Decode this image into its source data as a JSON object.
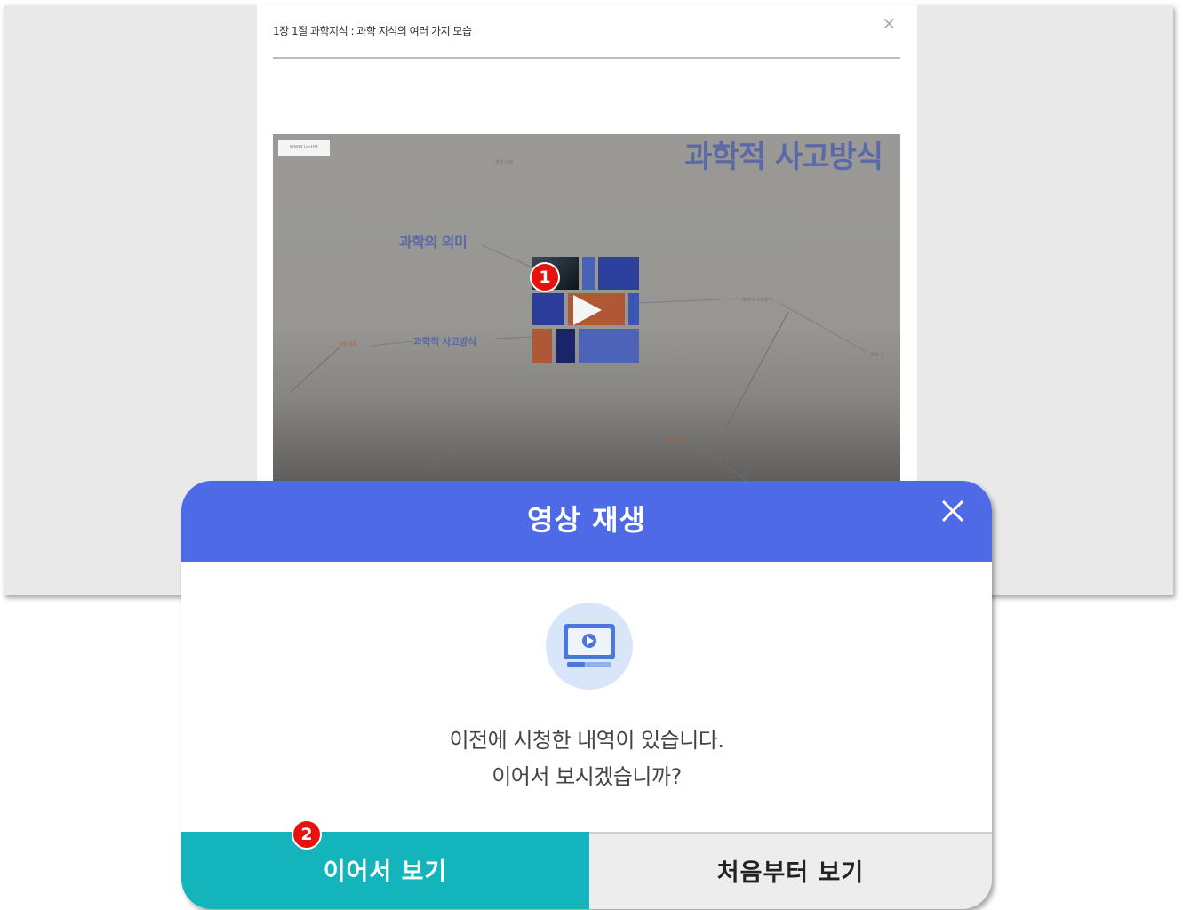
{
  "lecture": {
    "title": "1장 1절 과학지식 : 과학 지식의 여러 가지 모습",
    "close_label": "×",
    "video": {
      "tag": "WWW.Lect01",
      "slide_title": "과학적 사고방식",
      "mindmap_main": [
        "과학의 의미",
        "과학적 사고방식"
      ],
      "mindmap_small": [
        "과학 의의",
        "과학적 사고방식",
        "과학 사",
        "과학 응용",
        "과학 사례",
        "과학"
      ]
    }
  },
  "markers": [
    "1",
    "2"
  ],
  "dialog": {
    "title": "영상 재생",
    "message_line1": "이전에 시청한 내역이 있습니다.",
    "message_line2": "이어서 보시겠습니까?",
    "continue_label": "이어서 보기",
    "restart_label": "처음부터 보기"
  },
  "colors": {
    "header": "#4f6ae6",
    "continue_button": "#13b4bc",
    "restart_button": "#ededed",
    "marker": "#e8110d"
  },
  "icons": {
    "dialog_close": "close-icon",
    "dialog_illustration": "video-player-icon",
    "video_play": "play-icon"
  }
}
